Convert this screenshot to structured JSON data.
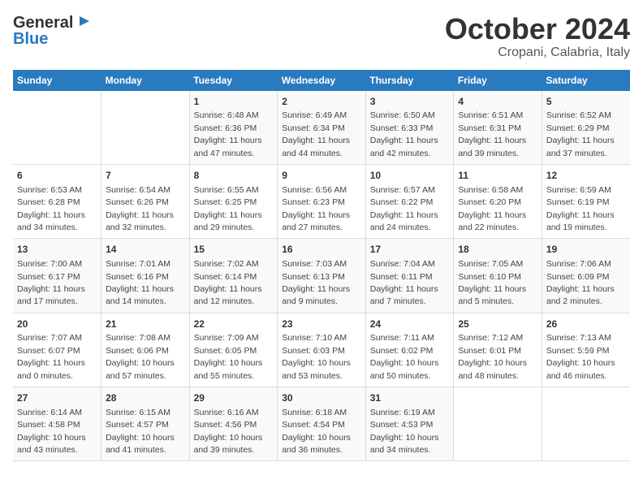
{
  "header": {
    "logo_general": "General",
    "logo_blue": "Blue",
    "title": "October 2024",
    "location": "Cropani, Calabria, Italy"
  },
  "days_of_week": [
    "Sunday",
    "Monday",
    "Tuesday",
    "Wednesday",
    "Thursday",
    "Friday",
    "Saturday"
  ],
  "weeks": [
    [
      {
        "day": "",
        "detail": ""
      },
      {
        "day": "",
        "detail": ""
      },
      {
        "day": "1",
        "detail": "Sunrise: 6:48 AM\nSunset: 6:36 PM\nDaylight: 11 hours and 47 minutes."
      },
      {
        "day": "2",
        "detail": "Sunrise: 6:49 AM\nSunset: 6:34 PM\nDaylight: 11 hours and 44 minutes."
      },
      {
        "day": "3",
        "detail": "Sunrise: 6:50 AM\nSunset: 6:33 PM\nDaylight: 11 hours and 42 minutes."
      },
      {
        "day": "4",
        "detail": "Sunrise: 6:51 AM\nSunset: 6:31 PM\nDaylight: 11 hours and 39 minutes."
      },
      {
        "day": "5",
        "detail": "Sunrise: 6:52 AM\nSunset: 6:29 PM\nDaylight: 11 hours and 37 minutes."
      }
    ],
    [
      {
        "day": "6",
        "detail": "Sunrise: 6:53 AM\nSunset: 6:28 PM\nDaylight: 11 hours and 34 minutes."
      },
      {
        "day": "7",
        "detail": "Sunrise: 6:54 AM\nSunset: 6:26 PM\nDaylight: 11 hours and 32 minutes."
      },
      {
        "day": "8",
        "detail": "Sunrise: 6:55 AM\nSunset: 6:25 PM\nDaylight: 11 hours and 29 minutes."
      },
      {
        "day": "9",
        "detail": "Sunrise: 6:56 AM\nSunset: 6:23 PM\nDaylight: 11 hours and 27 minutes."
      },
      {
        "day": "10",
        "detail": "Sunrise: 6:57 AM\nSunset: 6:22 PM\nDaylight: 11 hours and 24 minutes."
      },
      {
        "day": "11",
        "detail": "Sunrise: 6:58 AM\nSunset: 6:20 PM\nDaylight: 11 hours and 22 minutes."
      },
      {
        "day": "12",
        "detail": "Sunrise: 6:59 AM\nSunset: 6:19 PM\nDaylight: 11 hours and 19 minutes."
      }
    ],
    [
      {
        "day": "13",
        "detail": "Sunrise: 7:00 AM\nSunset: 6:17 PM\nDaylight: 11 hours and 17 minutes."
      },
      {
        "day": "14",
        "detail": "Sunrise: 7:01 AM\nSunset: 6:16 PM\nDaylight: 11 hours and 14 minutes."
      },
      {
        "day": "15",
        "detail": "Sunrise: 7:02 AM\nSunset: 6:14 PM\nDaylight: 11 hours and 12 minutes."
      },
      {
        "day": "16",
        "detail": "Sunrise: 7:03 AM\nSunset: 6:13 PM\nDaylight: 11 hours and 9 minutes."
      },
      {
        "day": "17",
        "detail": "Sunrise: 7:04 AM\nSunset: 6:11 PM\nDaylight: 11 hours and 7 minutes."
      },
      {
        "day": "18",
        "detail": "Sunrise: 7:05 AM\nSunset: 6:10 PM\nDaylight: 11 hours and 5 minutes."
      },
      {
        "day": "19",
        "detail": "Sunrise: 7:06 AM\nSunset: 6:09 PM\nDaylight: 11 hours and 2 minutes."
      }
    ],
    [
      {
        "day": "20",
        "detail": "Sunrise: 7:07 AM\nSunset: 6:07 PM\nDaylight: 11 hours and 0 minutes."
      },
      {
        "day": "21",
        "detail": "Sunrise: 7:08 AM\nSunset: 6:06 PM\nDaylight: 10 hours and 57 minutes."
      },
      {
        "day": "22",
        "detail": "Sunrise: 7:09 AM\nSunset: 6:05 PM\nDaylight: 10 hours and 55 minutes."
      },
      {
        "day": "23",
        "detail": "Sunrise: 7:10 AM\nSunset: 6:03 PM\nDaylight: 10 hours and 53 minutes."
      },
      {
        "day": "24",
        "detail": "Sunrise: 7:11 AM\nSunset: 6:02 PM\nDaylight: 10 hours and 50 minutes."
      },
      {
        "day": "25",
        "detail": "Sunrise: 7:12 AM\nSunset: 6:01 PM\nDaylight: 10 hours and 48 minutes."
      },
      {
        "day": "26",
        "detail": "Sunrise: 7:13 AM\nSunset: 5:59 PM\nDaylight: 10 hours and 46 minutes."
      }
    ],
    [
      {
        "day": "27",
        "detail": "Sunrise: 6:14 AM\nSunset: 4:58 PM\nDaylight: 10 hours and 43 minutes."
      },
      {
        "day": "28",
        "detail": "Sunrise: 6:15 AM\nSunset: 4:57 PM\nDaylight: 10 hours and 41 minutes."
      },
      {
        "day": "29",
        "detail": "Sunrise: 6:16 AM\nSunset: 4:56 PM\nDaylight: 10 hours and 39 minutes."
      },
      {
        "day": "30",
        "detail": "Sunrise: 6:18 AM\nSunset: 4:54 PM\nDaylight: 10 hours and 36 minutes."
      },
      {
        "day": "31",
        "detail": "Sunrise: 6:19 AM\nSunset: 4:53 PM\nDaylight: 10 hours and 34 minutes."
      },
      {
        "day": "",
        "detail": ""
      },
      {
        "day": "",
        "detail": ""
      }
    ]
  ]
}
